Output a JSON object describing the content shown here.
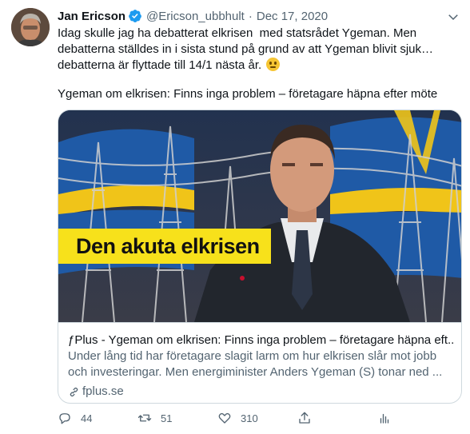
{
  "tweet": {
    "author_name": "Jan Ericson",
    "handle": "@Ericson_ubbhult",
    "separator": "·",
    "date": "Dec 17, 2020",
    "text": "Idag skulle jag ha debatterat elkrisen  med statsrådet Ygeman. Men debatterna ställdes in i sista stund på grund av att Ygeman blivit sjuk…debatterna är flyttade till 14/1 nästa år.",
    "headline": "Ygeman om elkrisen: Finns inga problem – företagare häpna efter möte",
    "icons": [
      "verified-badge-icon",
      "more-caret-icon",
      "reply-icon",
      "retweet-icon",
      "like-icon",
      "analytics-icon",
      "link-icon",
      "neutral-face-emoji"
    ]
  },
  "card": {
    "image_banner": "Den akuta elkrisen",
    "title": "ƒPlus - Ygeman om elkrisen: Finns inga problem – företagare häpna eft...",
    "description": "Under lång tid har företagare slagit larm om hur elkrisen slår mot jobb och investeringar. Men energiminister Anders Ygeman (S) tonar ned ...",
    "domain": "fplus.se"
  },
  "actions": {
    "replies": "44",
    "retweets": "51",
    "likes": "310"
  },
  "colors": {
    "accent": "#1d9bf0",
    "secondary_text": "#536471",
    "banner_yellow": "#f7e11b",
    "flag_blue": "#1f5aa6",
    "flag_yellow": "#f0c419"
  }
}
